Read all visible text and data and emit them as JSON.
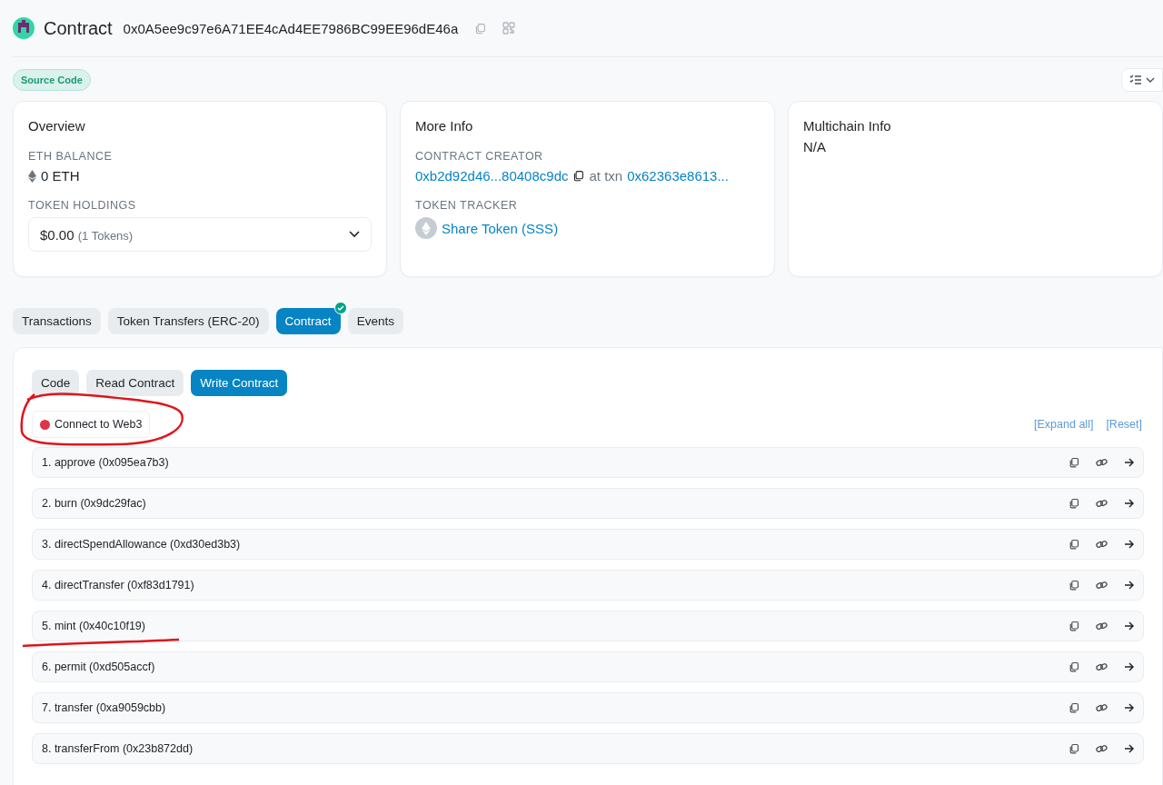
{
  "header": {
    "title": "Contract",
    "address": "0x0A5ee9c97e6A71EE4cAd4EE7986BC99EE96dE46a"
  },
  "badge": "Source Code",
  "cards": [
    {
      "title": "Overview",
      "sections": [
        {
          "label": "ETH BALANCE",
          "kind": "balance",
          "value": "0 ETH"
        },
        {
          "label": "TOKEN HOLDINGS",
          "kind": "dropdown",
          "value": "$0.00",
          "note": "(1 Tokens)"
        }
      ]
    },
    {
      "title": "More Info",
      "sections": [
        {
          "label": "CONTRACT CREATOR",
          "kind": "creator",
          "creator": "0xb2d92d46...80408c9dc",
          "middle": "at txn",
          "txn": "0x62363e8613..."
        },
        {
          "label": "TOKEN TRACKER",
          "kind": "token",
          "value": "Share Token (SSS)"
        }
      ]
    },
    {
      "title": "Multichain Info",
      "sections": [
        {
          "kind": "plain",
          "value": "N/A"
        }
      ]
    }
  ],
  "tabs": [
    {
      "label": "Transactions",
      "selected": false,
      "verified": false
    },
    {
      "label": "Token Transfers (ERC-20)",
      "selected": false,
      "verified": false
    },
    {
      "label": "Contract",
      "selected": true,
      "verified": true
    },
    {
      "label": "Events",
      "selected": false,
      "verified": false
    }
  ],
  "subtabs": [
    {
      "label": "Code",
      "selected": false
    },
    {
      "label": "Read Contract",
      "selected": false
    },
    {
      "label": "Write Contract",
      "selected": true
    }
  ],
  "connect": {
    "label": "Connect to Web3",
    "connected": false
  },
  "links": [
    "[Expand all]",
    "[Reset]"
  ],
  "functions": [
    "1. approve (0x095ea7b3)",
    "2. burn (0x9dc29fac)",
    "3. directSpendAllowance (0xd30ed3b3)",
    "4. directTransfer (0xf83d1791)",
    "5. mint (0x40c10f19)",
    "6. permit (0xd505accf)",
    "7. transfer (0xa9059cbb)",
    "8. transferFrom (0x23b872dd)"
  ]
}
